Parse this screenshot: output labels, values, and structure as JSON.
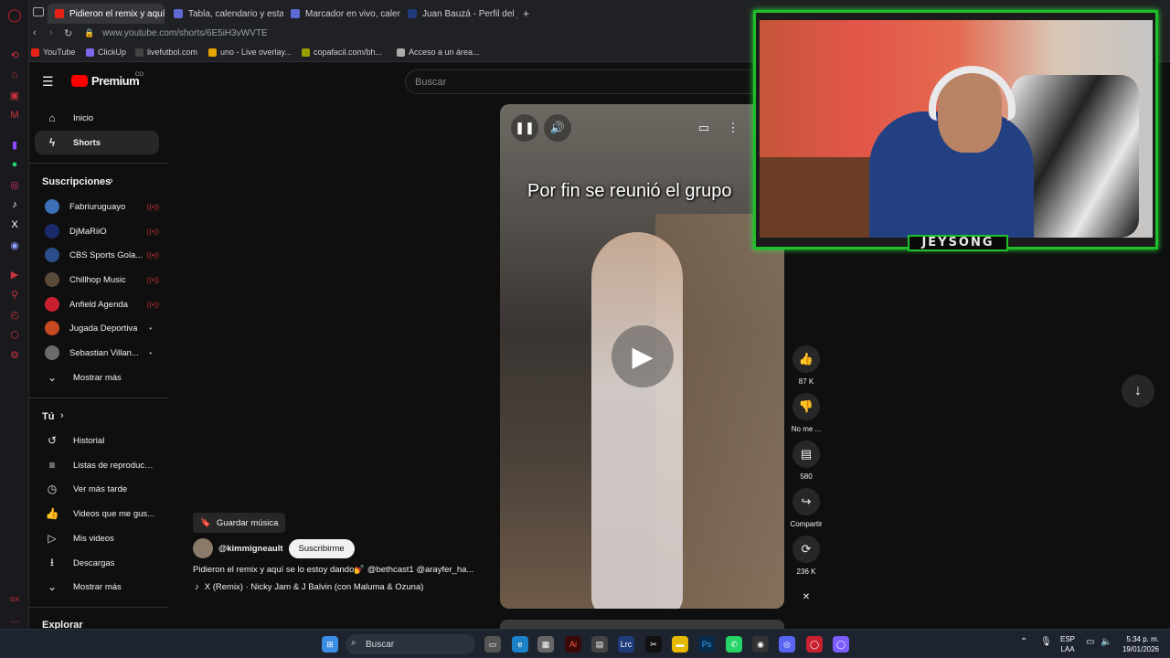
{
  "browser": {
    "tabs": [
      {
        "title": "Pidieron el remix y aquí",
        "color": "#e62117",
        "active": true
      },
      {
        "title": "Tabla, calendario y estadí",
        "color": "#5f6ad6"
      },
      {
        "title": "Marcador en vivo, calenda",
        "color": "#5f6ad6"
      },
      {
        "title": "Juan Bauzá - Perfil del jug",
        "color": "#1f3b7a"
      }
    ],
    "new_tab": "+",
    "url": "www.youtube.com/shorts/6E5iH3vWVTE",
    "bookmarks": [
      "YouTube",
      "ClickUp",
      "livefutbol.com",
      "uno - Live overlay...",
      "copafacil.com/bh...",
      "Acceso a un área..."
    ]
  },
  "youtube": {
    "logo": "Premium",
    "logo_sup": "CO",
    "search_placeholder": "Buscar",
    "nav": {
      "home": "Inicio",
      "shorts": "Shorts"
    },
    "subscriptions_title": "Suscripciones",
    "subscriptions": [
      {
        "name": "Fabriuruguayo",
        "color": "#3b6fb6",
        "live": true
      },
      {
        "name": "DjMaRiiO",
        "color": "#1a2a6b",
        "live": true
      },
      {
        "name": "CBS Sports Gola...",
        "color": "#2d4d8a",
        "live": true
      },
      {
        "name": "Chillhop Music",
        "color": "#5a4a3a",
        "live": true
      },
      {
        "name": "Anfield Agenda",
        "color": "#c8202f",
        "live": true
      },
      {
        "name": "Jugada Deportiva",
        "color": "#c84a20",
        "live": false
      },
      {
        "name": "Sebastian Villan...",
        "color": "#6b6b6b",
        "live": false
      }
    ],
    "show_more": "Mostrar más",
    "you_title": "Tú",
    "you_items": [
      "Historial",
      "Listas de reproducc...",
      "Ver más tarde",
      "Videos que me gus...",
      "Mis videos",
      "Descargas",
      "Mostrar más"
    ],
    "explore_title": "Explorar"
  },
  "short": {
    "caption_overlay": "Por fin se reunió el grupo",
    "save_music": "Guardar música",
    "channel": "@kimmigneault",
    "subscribe": "Suscribirme",
    "description": "Pidieron el remix y aquí se lo estoy dando💅 @bethcast1 @arayfer_ha...",
    "song": "X (Remix) · Nicky Jam & J Balvin (con Maluma & Ozuna)",
    "actions": {
      "likes": "87 K",
      "dislike": "No me ...",
      "comments": "580",
      "share": "Compartir",
      "remix": "236 K"
    }
  },
  "webcam": {
    "name": "JEYSONG"
  },
  "taskbar": {
    "search": "Buscar",
    "lang_top": "ESP",
    "lang_bottom": "LAA",
    "time": "5:34 p. m.",
    "date": "19/01/2026"
  },
  "colors": {
    "accent_red": "#ff0000",
    "webcam_border": "#1fbf2a"
  }
}
